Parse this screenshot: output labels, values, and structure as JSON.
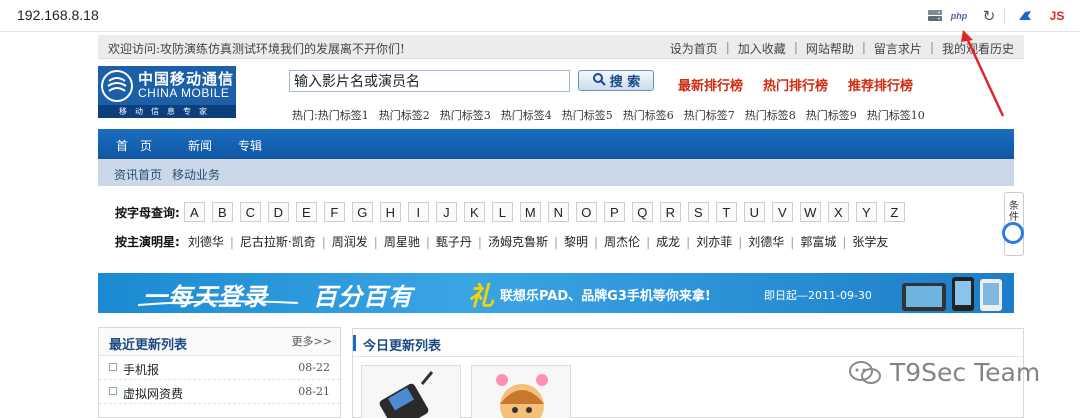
{
  "browser": {
    "url": "192.168.8.18",
    "extensions": {
      "php_label": "php",
      "js_label": "JS"
    },
    "icons": [
      "server-icon",
      "php-icon",
      "reload-icon",
      "bird-icon",
      "js-icon"
    ]
  },
  "top_bar": {
    "welcome": "欢迎访问:攻防演练仿真测试环境我们的发展离不开你们!",
    "links": [
      "设为首页",
      "加入收藏",
      "网站帮助",
      "留言求片",
      "我的观看历史"
    ]
  },
  "logo": {
    "cn": "中国移动通信",
    "en": "CHINA MOBILE",
    "sub": "移动信息专家"
  },
  "search": {
    "value": "输入影片名或演员名",
    "button_label": "搜 索"
  },
  "rankings": [
    "最新排行榜",
    "热门排行榜",
    "推荐排行榜"
  ],
  "hot_tags": {
    "label": "热门:",
    "tags": [
      "热门标签1",
      "热门标签2",
      "热门标签3",
      "热门标签4",
      "热门标签5",
      "热门标签6",
      "热门标签7",
      "热门标签8",
      "热门标签9",
      "热门标签10"
    ]
  },
  "nav": {
    "main": [
      "首　页",
      "新闻",
      "专辑"
    ],
    "sub": [
      "资讯首页",
      "移动业务"
    ]
  },
  "letter_query": {
    "label": "按字母查询:",
    "letters": [
      "A",
      "B",
      "C",
      "D",
      "E",
      "F",
      "G",
      "H",
      "I",
      "J",
      "K",
      "L",
      "M",
      "N",
      "O",
      "P",
      "Q",
      "R",
      "S",
      "T",
      "U",
      "V",
      "W",
      "X",
      "Y",
      "Z"
    ]
  },
  "star_query": {
    "label": "按主演明星:",
    "stars": [
      "刘德华",
      "尼古拉斯·凯奇",
      "周润发",
      "周星驰",
      "甄子丹",
      "汤姆克鲁斯",
      "黎明",
      "周杰伦",
      "成龙",
      "刘亦菲",
      "刘德华",
      "郭富城",
      "张学友"
    ]
  },
  "side_float": {
    "text": "条件查询"
  },
  "banner": {
    "part1": "一每天登录",
    "part2": "百分百有",
    "li": "礼",
    "promo": "联想乐PAD、品牌G3手机等你来拿!",
    "date": "即日起—2011-09-30"
  },
  "recent_list": {
    "title": "最近更新列表",
    "more": "更多>>",
    "items": [
      {
        "name": "手机报",
        "date": "08-22"
      },
      {
        "name": "虚拟网资费",
        "date": "08-21"
      }
    ]
  },
  "today_list": {
    "title": "今日更新列表"
  },
  "watermark": {
    "text": "T9Sec Team"
  },
  "colors": {
    "nav_blue": "#1b6dbf",
    "rank_red": "#d02a10",
    "annotation_red": "#e0262a",
    "logo_blue": "#1a5fa8"
  }
}
